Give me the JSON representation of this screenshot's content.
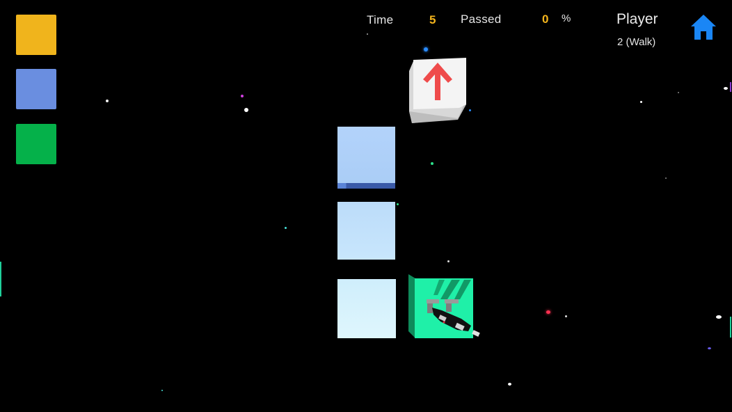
{
  "hud": {
    "time_label": "Time",
    "time_value": "5",
    "passed_label": "Passed",
    "passed_value": "0",
    "passed_unit": "%",
    "player_label": "Player",
    "player_mode": "2 (Walk)",
    "home_icon": "home-icon"
  },
  "palette": {
    "swatches": [
      {
        "name": "yellow",
        "color": "#f0b41c"
      },
      {
        "name": "blue",
        "color": "#6a8ee0"
      },
      {
        "name": "green",
        "color": "#05b14a"
      }
    ]
  },
  "board": {
    "tiles": [
      {
        "name": "light-blue-tile-top",
        "color": "#aecff8"
      },
      {
        "name": "light-blue-tile-middle",
        "color": "#c0e0fa"
      },
      {
        "name": "light-blue-tile-bottom",
        "color": "#d6f2fc"
      }
    ],
    "arrow_block": {
      "icon": "arrow-up-icon",
      "face_color": "#f4f4f4",
      "arrow_color": "#ef4b4b"
    },
    "goal_block": {
      "color": "#1ff0a8",
      "character": "robot-character"
    }
  },
  "colors": {
    "accent_time": "#f5b51c",
    "home_blue": "#1a86f5",
    "background": "#000000"
  }
}
